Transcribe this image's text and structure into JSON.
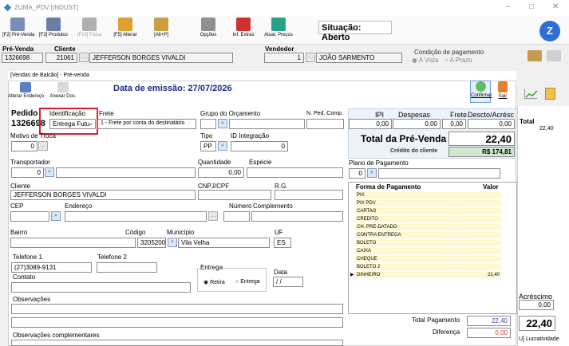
{
  "window": {
    "title": "ZUMA_PDV [INDUST]",
    "min": "–",
    "max": "□",
    "close": "✕"
  },
  "toolbar": {
    "buttons": [
      {
        "label": "[F2] Pré-Venda",
        "icon": "document-list-icon",
        "color": "#7a8fb8"
      },
      {
        "label": "[F3] Produtos",
        "icon": "cart-icon",
        "color": "#6a7fa8"
      },
      {
        "label": "[F10] Troca",
        "icon": "exchange-icon",
        "color": "#b0b0b0"
      },
      {
        "label": "[F5] Alterar",
        "icon": "edit-icon",
        "color": "#e0a030"
      },
      {
        "label": "[Alt+P]",
        "icon": "calculator-icon",
        "color": "#c8a040"
      },
      {
        "label": "Opções",
        "icon": "tools-icon",
        "color": "#909090"
      },
      {
        "label": "Inf. Extras",
        "icon": "book-icon",
        "color": "#d03030"
      },
      {
        "label": "Atual. Preços",
        "icon": "refresh-price-icon",
        "color": "#2aa088"
      }
    ],
    "situacao": "Situação: Aberto"
  },
  "header": {
    "pre_venda_label": "Pré-Venda",
    "pre_venda": "1326698",
    "cliente_label": "Cliente",
    "cliente_codigo": "21061",
    "cliente_nome": "JEFFERSON BORGES VIVALDI",
    "vendedor_label": "Vendedor",
    "vendedor_codigo": "1",
    "vendedor_nome": "JOÃO SARMENTO",
    "condicao_label": "Condição de pagamento",
    "a_vista": "A Vista",
    "a_prazo": "A Prazo"
  },
  "tab": {
    "title": "[Vendas de Balcão] - Pré-venda"
  },
  "actions": {
    "alterar_endereco": "Alterar Endereço",
    "anexar_doc": "Anexar Doc.",
    "confirmar": "Confirmar",
    "sair": "Sair"
  },
  "emissao": "Data de emissão: 27/07/2026",
  "form": {
    "pedido_label": "Pedido",
    "pedido": "1326698",
    "identificacao_label": "Identificação",
    "identificacao": "Entrega Futu",
    "frete_label": "Frete",
    "frete": "1 - Frete por conta do destinatário",
    "grupo_label": "Grupo do Orçamento",
    "nped_label": "N. Ped. Comp.",
    "motivo_troca_label": "Motivo de Troca",
    "motivo_troca": "0",
    "tipo_label": "Tipo",
    "tipo": "PP",
    "id_integracao_label": "ID Integração",
    "id_integracao": "0",
    "transportador_label": "Transportador",
    "transportador": "0",
    "quantidade_label": "Quantidade",
    "quantidade": "0,00",
    "especie_label": "Espécie",
    "plano_label": "Plano de Pagamento",
    "plano": "0",
    "cliente_label": "Cliente",
    "cliente": "JEFFERSON BORGES VIVALDI",
    "cnpj_label": "CNPJ/CPF",
    "rg_label": "R.G.",
    "cep_label": "CEP",
    "endereco_label": "Endereço",
    "numero_label": "Número",
    "complemento_label": "Complemento",
    "bairro_label": "Bairro",
    "codigo_label": "Código",
    "municipio_label": "Município",
    "codigo": "3205200",
    "municipio": "Vila Velha",
    "uf_label": "UF",
    "uf": "ES",
    "telefone1_label": "Telefone 1",
    "telefone1": "(27)3089-9131",
    "telefone2_label": "Telefone 2",
    "contato_label": "Contato",
    "entrega_label": "Entrega",
    "retira": "Retira",
    "entrega": "Entrega",
    "data_label": "Data",
    "data": " /  /",
    "observacoes_label": "Observações",
    "obs_compl_label": "Observações complementares"
  },
  "totals": {
    "ipi_label": "IPI",
    "despesas_label": "Despesas",
    "frete_label": "Frete",
    "descto_label": "Descto/Acrésc",
    "ipi": "0,00",
    "despesas": "0,00",
    "frete": "0,00",
    "descto": "0,00",
    "total_label": "Total da Pré-Venda",
    "total": "22,40",
    "credito_label": "Crédito do cliente",
    "credito": "R$ 174,81"
  },
  "pagamento": {
    "col_forma": "Forma de Pagamento",
    "col_valor": "Valor",
    "rows": [
      {
        "forma": "PIX",
        "valor": ""
      },
      {
        "forma": "PIX PDV",
        "valor": ""
      },
      {
        "forma": "CARTAO",
        "valor": ""
      },
      {
        "forma": "CREDITO",
        "valor": ""
      },
      {
        "forma": "CH. PRE-DATADO",
        "valor": ""
      },
      {
        "forma": "CONTRA ENTREGA",
        "valor": ""
      },
      {
        "forma": "BOLETO",
        "valor": ""
      },
      {
        "forma": "CAIXA",
        "valor": ""
      },
      {
        "forma": "CHEQUE",
        "valor": ""
      },
      {
        "forma": "BOLETO 2",
        "valor": ""
      },
      {
        "forma": "DINHEIRO",
        "valor": "22,40"
      }
    ],
    "total_pagamento_label": "Total Pagamento",
    "total_pagamento": "22,40",
    "diferenca_label": "Diferença",
    "diferenca": "0,00"
  },
  "side": {
    "total_label": "Total",
    "total": "22,40",
    "acrescimo_label": "Acréscimo",
    "acrescimo": "0,00",
    "total_big": "22,40",
    "lucratividade": "U] Lucratividade"
  }
}
